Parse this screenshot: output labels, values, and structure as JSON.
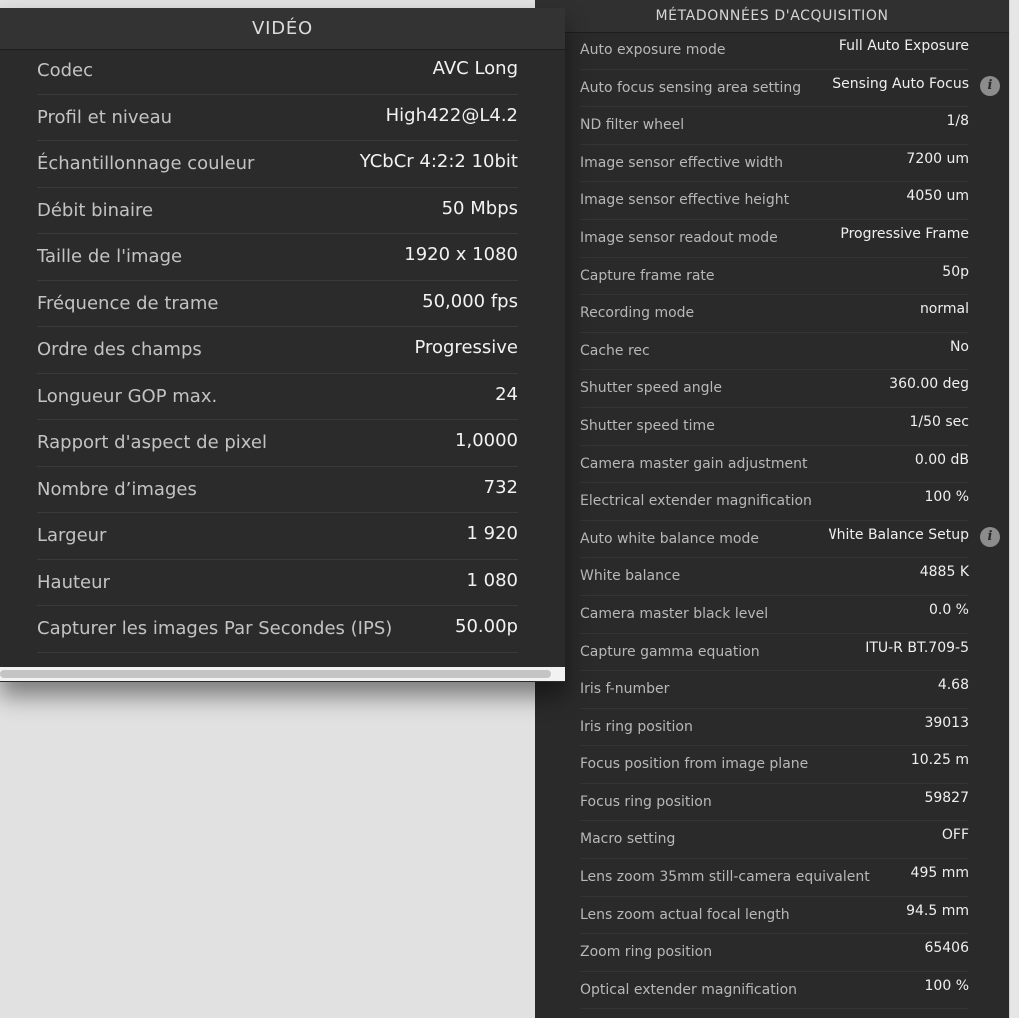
{
  "video": {
    "title": "VIDÉO",
    "rows": [
      {
        "label": "Codec",
        "value": "AVC Long"
      },
      {
        "label": "Profil et niveau",
        "value": "High422@L4.2"
      },
      {
        "label": "Échantillonnage couleur",
        "value": "YCbCr 4:2:2 10bit"
      },
      {
        "label": "Débit binaire",
        "value": "50 Mbps"
      },
      {
        "label": "Taille de l'image",
        "value": "1920 x 1080"
      },
      {
        "label": "Fréquence de trame",
        "value": "50,000 fps"
      },
      {
        "label": "Ordre des champs",
        "value": "Progressive"
      },
      {
        "label": "Longueur GOP max.",
        "value": "24"
      },
      {
        "label": "Rapport d'aspect de pixel",
        "value": "1,0000"
      },
      {
        "label": "Nombre d’images",
        "value": "732"
      },
      {
        "label": "Largeur",
        "value": "1 920"
      },
      {
        "label": "Hauteur",
        "value": "1 080"
      },
      {
        "label": "Capturer les images Par Secondes (IPS)",
        "value": "50.00p"
      }
    ]
  },
  "acquisition": {
    "title": "MÉTADONNÉES D'ACQUISITION",
    "rows": [
      {
        "label": "Auto exposure mode",
        "value": "Full Auto Exposure"
      },
      {
        "label": "Auto focus sensing area setting",
        "value": "Sensing Auto Focus",
        "info_icon": "info-icon"
      },
      {
        "label": "ND filter wheel",
        "value": "1/8"
      },
      {
        "label": "Image sensor effective width",
        "value": "7200 um"
      },
      {
        "label": "Image sensor effective height",
        "value": "4050 um"
      },
      {
        "label": "Image sensor readout mode",
        "value": "Progressive Frame"
      },
      {
        "label": "Capture frame rate",
        "value": "50p"
      },
      {
        "label": "Recording mode",
        "value": "normal"
      },
      {
        "label": "Cache rec",
        "value": "No"
      },
      {
        "label": "Shutter speed angle",
        "value": "360.00 deg"
      },
      {
        "label": "Shutter speed time",
        "value": "1/50 sec"
      },
      {
        "label": "Camera master gain adjustment",
        "value": "0.00 dB"
      },
      {
        "label": "Electrical extender magnification",
        "value": "100 %"
      },
      {
        "label": "Auto white balance mode",
        "value": "Auto White Balance Setup",
        "info_icon": "info-icon"
      },
      {
        "label": "White balance",
        "value": "4885 K"
      },
      {
        "label": "Camera master black level",
        "value": "0.0 %"
      },
      {
        "label": "Capture gamma equation",
        "value": "ITU-R BT.709-5"
      },
      {
        "label": "Iris f-number",
        "value": "4.68"
      },
      {
        "label": "Iris ring position",
        "value": "39013"
      },
      {
        "label": "Focus position from image plane",
        "value": "10.25 m"
      },
      {
        "label": "Focus ring position",
        "value": "59827"
      },
      {
        "label": "Macro setting",
        "value": "OFF"
      },
      {
        "label": "Lens zoom 35mm still-camera equivalent",
        "value": "495 mm"
      },
      {
        "label": "Lens zoom actual focal length",
        "value": "94.5 mm"
      },
      {
        "label": "Zoom ring position",
        "value": "65406"
      },
      {
        "label": "Optical extender magnification",
        "value": "100 %"
      }
    ]
  },
  "colors": {
    "panel_bg": "#2b2b2b",
    "page_bg": "#e1e1e1",
    "label_text": "#c3c3c3",
    "value_text": "#f2f2f2"
  }
}
